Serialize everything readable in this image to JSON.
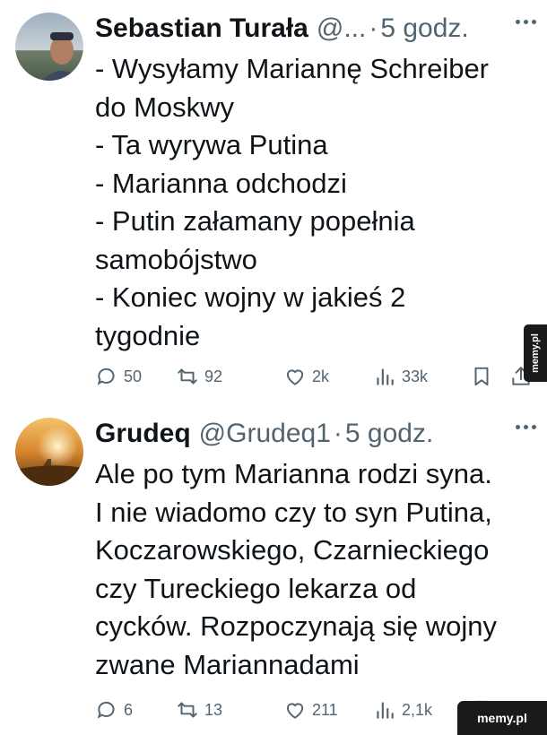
{
  "tweets": [
    {
      "name": "Sebastian Turała",
      "handle": "@...",
      "separator": "·",
      "time": "5 godz.",
      "lines": [
        "- Wysyłamy Mariannę Schreiber",
        "do Moskwy",
        "- Ta wyrywa Putina",
        "- Marianna odchodzi",
        "- Putin załamany popełnia",
        "samobójstwo",
        "- Koniec wojny w jakieś 2",
        "tygodnie"
      ],
      "stats": {
        "replies": "50",
        "retweets": "92",
        "likes": "2k",
        "views": "33k"
      }
    },
    {
      "name": "Grudeq",
      "handle": "@Grudeq1",
      "separator": "·",
      "time": "5 godz.",
      "lines": [
        "Ale po tym Marianna rodzi syna.",
        "I nie wiadomo czy to syn Putina,",
        "Koczarowskiego, Czarnieckiego",
        "czy Tureckiego lekarza od",
        "cycków. Rozpoczynają się wojny",
        "zwane Mariannadami"
      ],
      "stats": {
        "replies": "6",
        "retweets": "13",
        "likes": "211",
        "views": "2,1k"
      }
    }
  ],
  "icons": {
    "reply": "reply-icon",
    "retweet": "retweet-icon",
    "like": "heart-icon",
    "views": "views-icon",
    "bookmark": "bookmark-icon",
    "share": "share-icon",
    "more": "more-options-icon"
  },
  "colors": {
    "text": "#0f1419",
    "muted": "#536471",
    "background": "#ffffff",
    "watermark_bg": "#1a1a1a"
  },
  "watermark": {
    "side": "memy.pl",
    "corner": "memy.pl"
  }
}
